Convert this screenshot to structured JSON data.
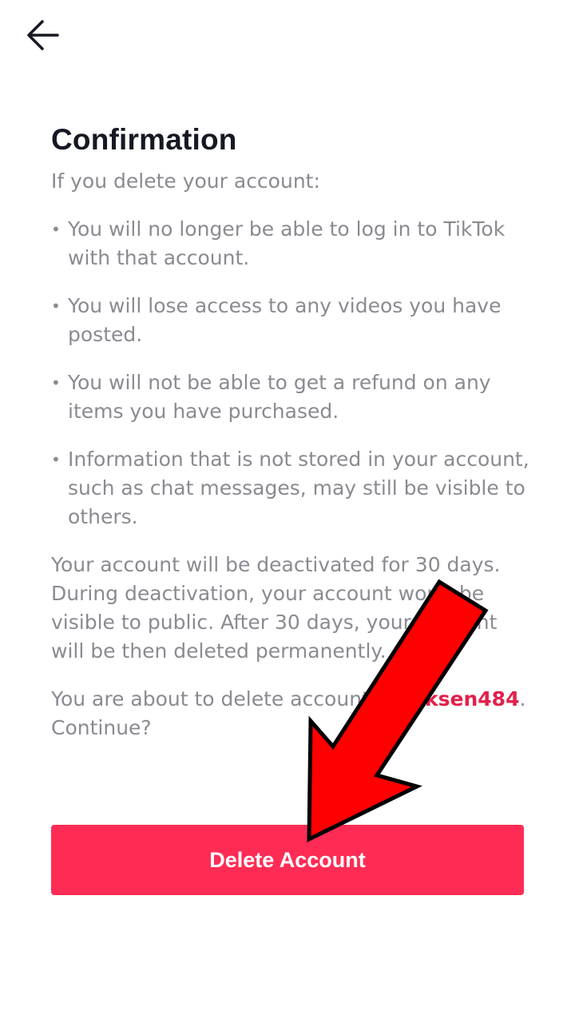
{
  "header": {
    "back_icon": "back-arrow-icon"
  },
  "main": {
    "title": "Confirmation",
    "intro": "If you delete your account:",
    "bullets": [
      "You will no longer be able to log in to TikTok with that account.",
      "You will lose access to any videos you have posted.",
      "You will not be able to get a refund on any items you have purchased.",
      "Information that is not stored in your account, such as chat messages, may still be visible to others."
    ],
    "deactivation_text": "Your account will be deactivated for 30 days. During deactivation, your account won't be visible to public. After 30 days, your account will be then deleted permanently.",
    "about_to_delete_prefix": "You are about to delete account",
    "username": "dipaksen484",
    "continue_suffix": ". Continue?",
    "bullet_char": "•"
  },
  "footer": {
    "delete_button_label": "Delete Account"
  },
  "colors": {
    "accent": "#fe2c55",
    "username": "#e1204c",
    "body_text": "#8a8b91",
    "title_text": "#161823",
    "annotation_arrow": "#ff0000"
  }
}
